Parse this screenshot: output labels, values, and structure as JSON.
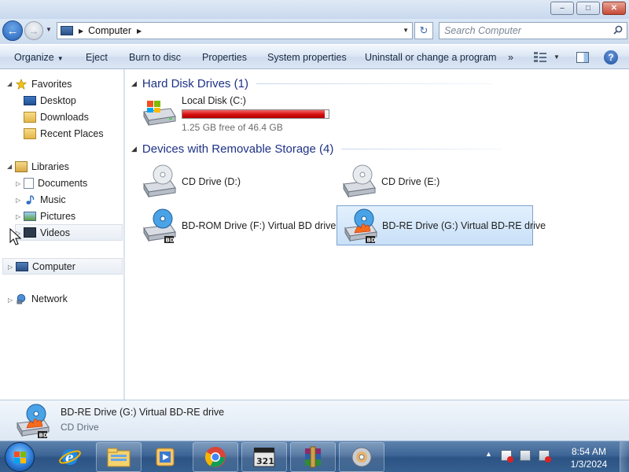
{
  "window": {
    "title_buttons": {
      "minimize": "–",
      "maximize": "□",
      "close": "✕"
    }
  },
  "address": {
    "location": "Computer",
    "search_placeholder": "Search Computer",
    "back_glyph": "←",
    "forward_glyph": "→",
    "refresh_glyph": "↻"
  },
  "toolbar": {
    "organize": "Organize",
    "eject": "Eject",
    "burn": "Burn to disc",
    "properties": "Properties",
    "system_properties": "System properties",
    "uninstall": "Uninstall or change a program",
    "more": "»",
    "help": "?"
  },
  "nav": {
    "favorites": "Favorites",
    "desktop": "Desktop",
    "downloads": "Downloads",
    "recent": "Recent Places",
    "libraries": "Libraries",
    "documents": "Documents",
    "music": "Music",
    "pictures": "Pictures",
    "videos": "Videos",
    "computer": "Computer",
    "network": "Network"
  },
  "groups": {
    "hdd": "Hard Disk Drives (1)",
    "removable": "Devices with Removable Storage (4)"
  },
  "drives": {
    "c": {
      "name": "Local Disk (C:)",
      "free": "1.25 GB free of 46.4 GB",
      "used_fraction": 0.973
    },
    "d": {
      "name": "CD Drive (D:)"
    },
    "e": {
      "name": "CD Drive (E:)"
    },
    "f": {
      "name": "BD-ROM Drive (F:) Virtual BD drive"
    },
    "g": {
      "name": "BD-RE Drive (G:) Virtual BD-RE drive"
    }
  },
  "details": {
    "name": "BD-RE Drive (G:) Virtual BD-RE drive",
    "type": "CD Drive"
  },
  "taskbar": {
    "time": "8:54 AM",
    "date": "1/3/2024",
    "tray_arrow": "▲"
  },
  "icons": {
    "ie": "internet-explorer-icon",
    "explorer": "windows-explorer-icon",
    "media": "media-player-icon",
    "chrome": "chrome-icon",
    "clapper": "media-player-classic-icon",
    "winrar": "winrar-icon",
    "disc": "disc-burner-icon"
  },
  "colors": {
    "group_heading": "#1e3287",
    "capacity_bar": "#d40f0f",
    "selection": "#c9e0f8"
  }
}
